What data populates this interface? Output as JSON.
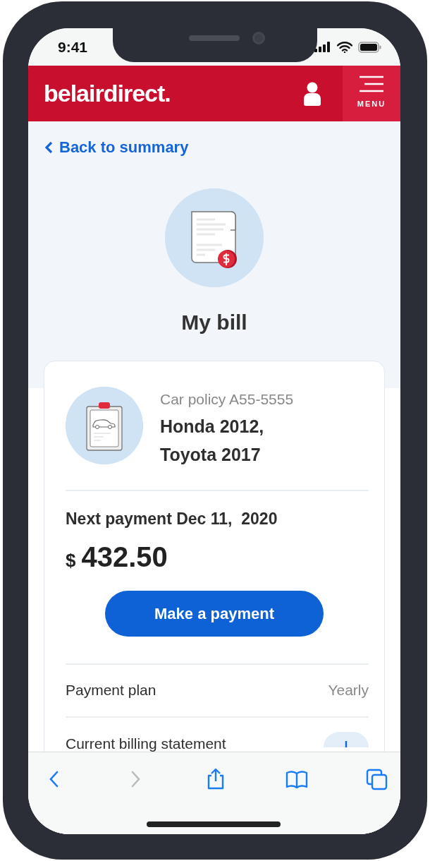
{
  "status_bar": {
    "time": "9:41"
  },
  "header": {
    "logo": "belairdirect.",
    "menu_label": "MENU"
  },
  "back_link": "Back to summary",
  "page_title": "My bill",
  "policy": {
    "label": "Car policy A55-5555",
    "vehicles": [
      "Honda 2012,",
      "Toyota 2017"
    ]
  },
  "payment": {
    "next": "Next payment Dec 11,  2020",
    "currency": "$",
    "amount": "432.50",
    "button": "Make a payment"
  },
  "details": [
    {
      "kind": "value",
      "label": "Payment plan",
      "value": "Yearly"
    },
    {
      "kind": "action",
      "label": "Current billing statement"
    }
  ],
  "browser_toolbar": [
    {
      "kind": "back",
      "disabled": false
    },
    {
      "kind": "forward",
      "disabled": true
    },
    {
      "kind": "share",
      "disabled": false
    },
    {
      "kind": "bookmarks",
      "disabled": false
    },
    {
      "kind": "tabs",
      "disabled": false
    }
  ]
}
